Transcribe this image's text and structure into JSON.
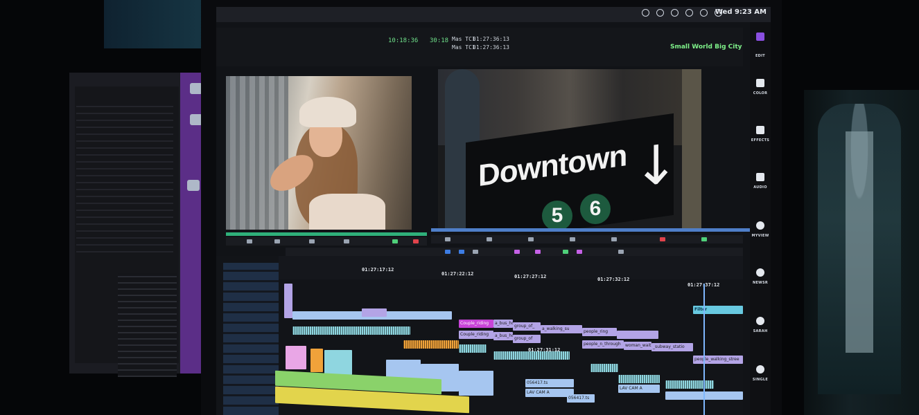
{
  "menubar": {
    "clock": "Wed 9:23 AM"
  },
  "project": {
    "name": "Small World Big City"
  },
  "timecodes": {
    "top_green_1": "10:18:36",
    "top_green_2": "30:18",
    "master_1": "01:27:36:13",
    "master_2": "01:27:36:13",
    "tc_label_1": "Mas TC1",
    "tc_label_2": "Mas TC1"
  },
  "record_monitor": {
    "sign_text": "Downtown",
    "badge_1": "5",
    "badge_2": "6"
  },
  "ruler": {
    "tc_1": "01:27:22:12",
    "tc_2": "01:27:27:12",
    "tc_3": "01:27:32:12",
    "tc_4": "01:27:37:12",
    "tc_5": "01:27:17:12"
  },
  "timeline": {
    "clips": {
      "couple_riding_1": "Couple_riding",
      "bus_holding_1": "a_bus_holding",
      "group_of_1": "group_of_",
      "man_walking": "a_walking_su",
      "people_ring": "people_ring",
      "couple_riding_2": "Couple_riding",
      "bus_holding_2": "a_bus_holding",
      "group_of_2": "group_of",
      "people_n_through": "people_n_through",
      "woman_waiting": "woman_waitin",
      "subway_station": "_subway_statio",
      "people_walking": "people_walking_stree",
      "filter": "Filter",
      "clip_tc": "01:27:31:12",
      "clip_id_1": "056417.ts",
      "clip_id_2": "056417.ts",
      "audio_lav": "LAV CAM A",
      "audio_lav_2": "LAV CAM A"
    }
  },
  "right_rail": {
    "items": [
      "EDIT",
      "COLOR",
      "EFFECTS",
      "AUDIO",
      "MYVIEW",
      "NEWSR",
      "SARAH",
      "SINGLE"
    ]
  },
  "colors": {
    "accent_green": "#6fe08a",
    "project_green": "#7ff28a",
    "purple": "#5b2e87",
    "magenta_clip": "#c844d8",
    "teal_clip": "#8fd6e0"
  }
}
